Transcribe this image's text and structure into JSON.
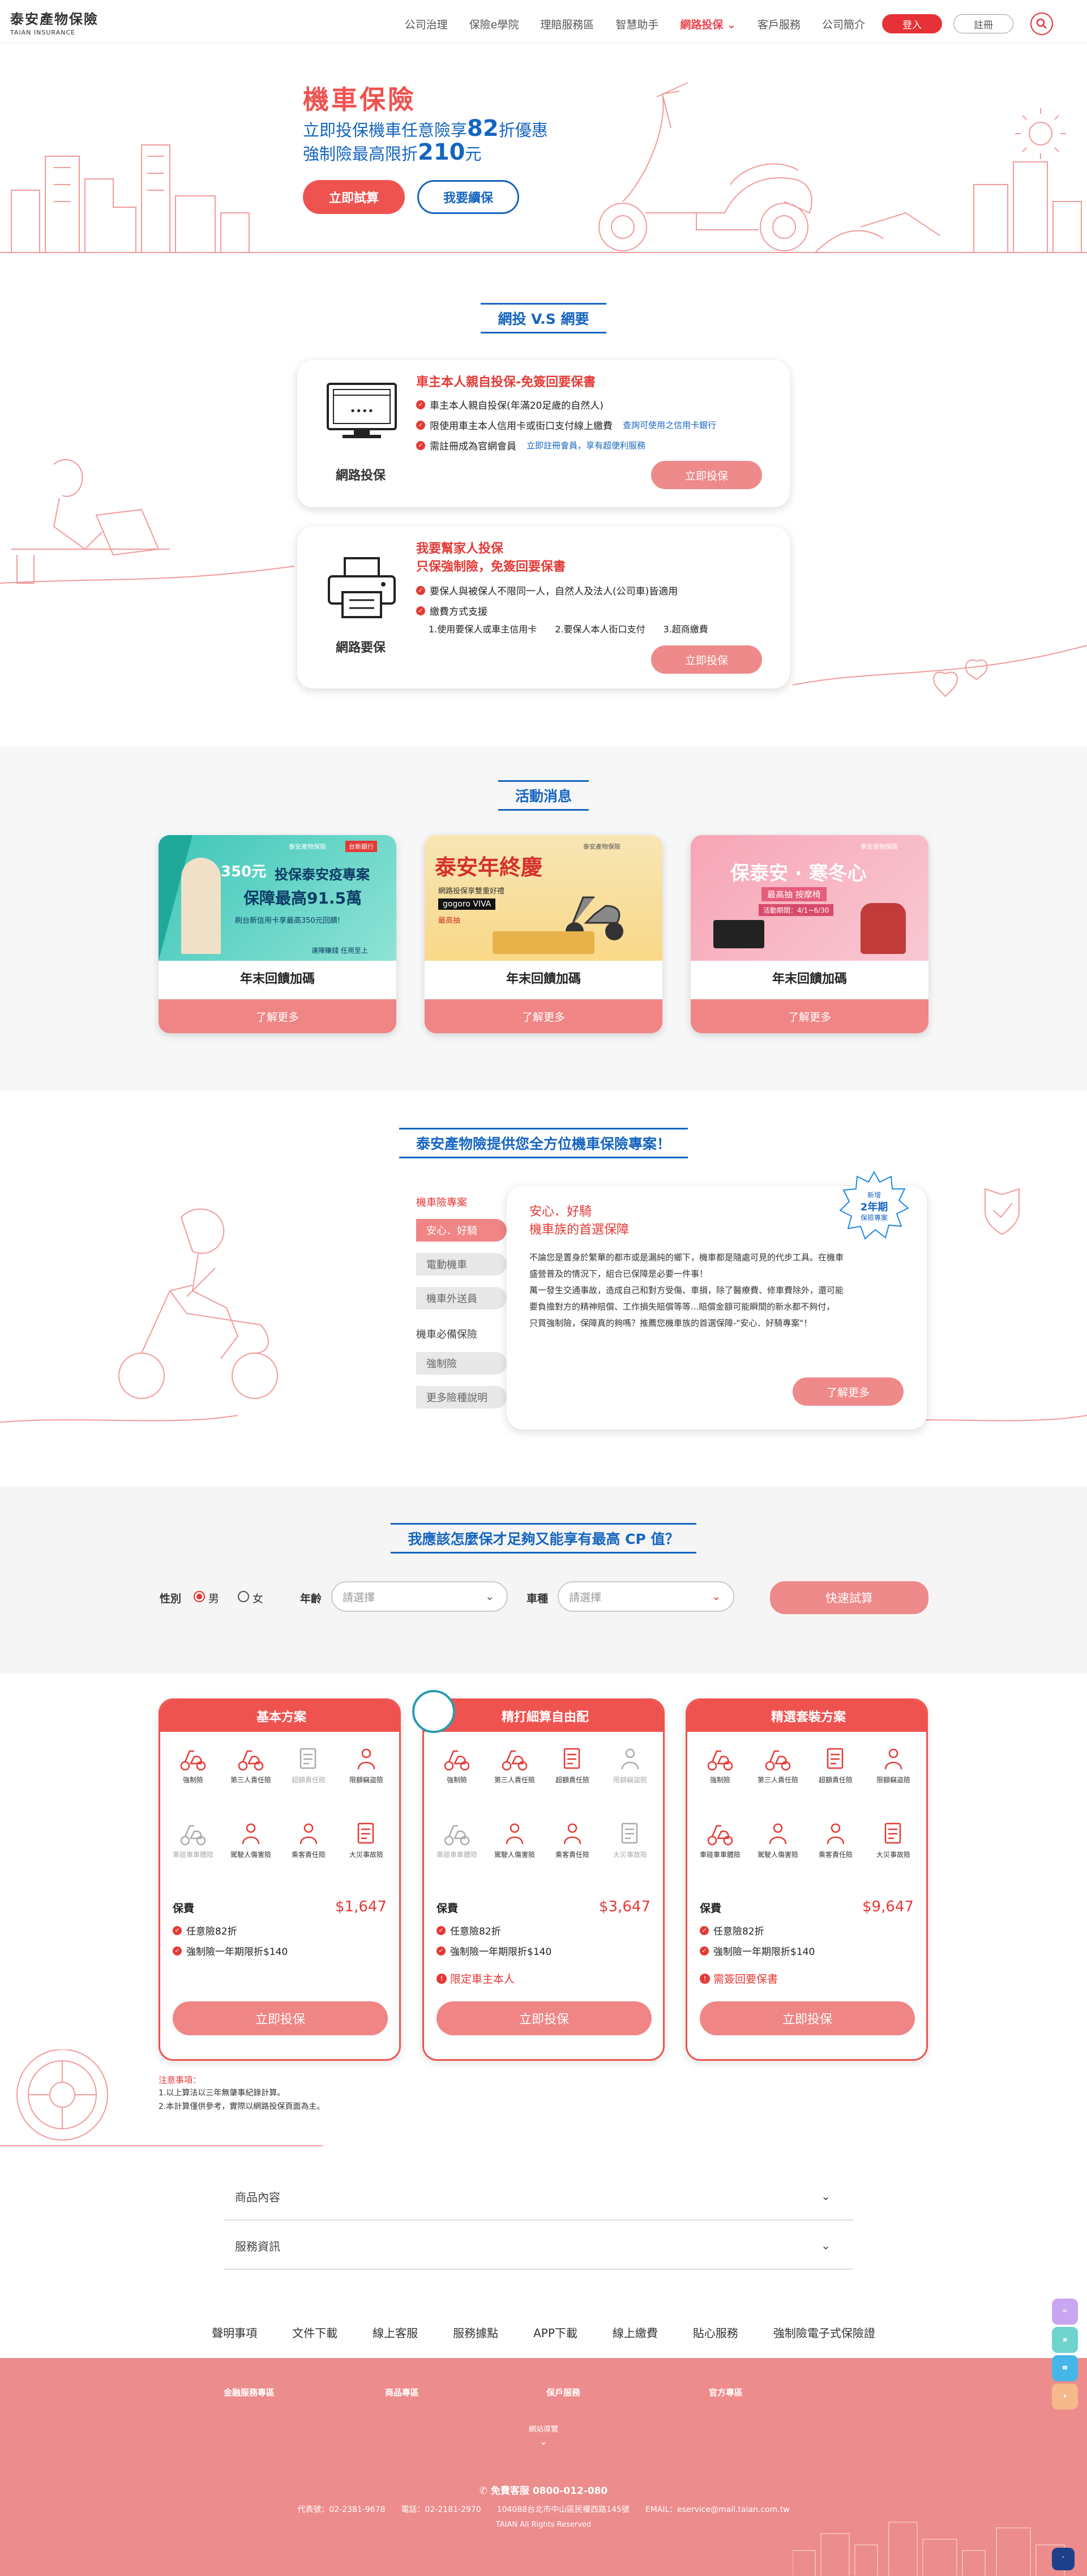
{
  "header": {
    "logo_zh": "泰安產物保險",
    "logo_en": "TAIAN INSURANCE",
    "nav": [
      "公司治理",
      "保險e學院",
      "理賠服務區",
      "智慧助手",
      "網路投保",
      "客戶服務",
      "公司簡介"
    ],
    "active_nav": "網路投保",
    "login": "登入",
    "register": "註冊"
  },
  "hero": {
    "title": "機車保險",
    "line1_pre": "立即投保機車任意險享",
    "line1_num": "82",
    "line1_post": "折優惠",
    "line2_pre": "強制險最高限折",
    "line2_num": "210",
    "line2_post": "元",
    "btn_try": "立即試算",
    "btn_renew": "我要續保"
  },
  "compare": {
    "title": "網投 V.S 網要",
    "online": {
      "label": "網路投保",
      "heading": "車主本人親自投保-免簽回要保書",
      "bullets": [
        "車主本人親自投保(年滿20足歲的自然人)",
        "限使用車主本人信用卡或街口支付線上繳費",
        "需註冊成為官網會員"
      ],
      "link1": "查詢可使用之信用卡銀行",
      "link2": "立即註冊會員，享有超便利服務",
      "button": "立即投保"
    },
    "request": {
      "label": "網路要保",
      "heading1": "我要幫家人投保",
      "heading2": "只保強制險，免簽回要保書",
      "bullets": [
        "要保人與被保人不限同一人，自然人及法人(公司車)皆適用",
        "繳費方式支援"
      ],
      "methods": "1.使用要保人或車主信用卡　　2.要保人本人街口支付　　3.超商繳費",
      "button": "立即投保"
    }
  },
  "promos": {
    "title": "活動消息",
    "items": [
      {
        "title": "年末回饋加碼",
        "button": "了解更多",
        "img_lines": [
          "350元",
          "投保泰安疫專案",
          "保障最高91.5萬",
          "刷台新信用卡享最高350元回饋!",
          "達陣賺錢 任用至上"
        ],
        "brand": "泰安產物保險",
        "bank": "台新銀行"
      },
      {
        "title": "年末回饋加碼",
        "button": "了解更多",
        "img_lines": [
          "泰安年終慶",
          "網路投保享雙重好禮",
          "gogoro VIVA",
          "最高抽"
        ],
        "brand": "泰安產物保險"
      },
      {
        "title": "年末回饋加碼",
        "button": "了解更多",
        "img_lines": [
          "保泰安 · 寒冬心",
          "最高抽 按摩椅",
          "活動期間：4/1~6/30"
        ],
        "brand": "泰安產物保險"
      }
    ]
  },
  "features": {
    "title": "泰安產物險提供您全方位機車保險專案！",
    "category1": "機車險專案",
    "menu1": [
      "安心．好騎",
      "電動機車",
      "機車外送員"
    ],
    "category2": "機車必備保險",
    "menu2": [
      "強制險",
      "更多險種說明"
    ],
    "card_title1": "安心．好騎",
    "card_title2": "機車族的首選保障",
    "badge": [
      "新增",
      "2年期",
      "保險專案"
    ],
    "body": [
      "不論您是置身於繁華的都市或是漏純的鄉下，機車都是隨處可見的代步工具。在機車",
      "盛營普及的情況下，組合已保障是必要一件事！",
      "萬一發生交通事故，造成自己和對方受傷、車損，除了醫療費、修車費除外，還可能",
      "要負擔對方的精神賠償、工作損失賠償等等...賠償金額可能瞬間的新水都不夠付，",
      "只買強制險，保障真的夠嗎？推薦您機車族的首選保障-\"安心．好騎專案\"！"
    ],
    "button": "了解更多"
  },
  "calc": {
    "title": "我應該怎麼保才足夠又能享有最高 CP 值？",
    "gender_label": "性別",
    "male": "男",
    "female": "女",
    "age_label": "年齡",
    "age_placeholder": "請選擇",
    "type_label": "車種",
    "type_placeholder": "請選擇",
    "button": "快速試算"
  },
  "plans": [
    {
      "name": "基本方案",
      "coverage": [
        {
          "label": "強制險",
          "on": true
        },
        {
          "label": "第三人責任險",
          "on": true
        },
        {
          "label": "超額責任險",
          "on": false
        },
        {
          "label": "限額竊盜險",
          "on": true
        },
        {
          "label": "車碰車車體險",
          "on": false
        },
        {
          "label": "駕駛人傷害險",
          "on": true
        },
        {
          "label": "乘客責任險",
          "on": true
        },
        {
          "label": "大災事故險",
          "on": true
        }
      ],
      "fee_label": "保費",
      "price": "$1,647",
      "lines": [
        "任意險82折",
        "強制險一年期限折$140"
      ],
      "warn": "",
      "button": "立即投保"
    },
    {
      "name": "精打細算自由配",
      "coverage": [
        {
          "label": "強制險",
          "on": true
        },
        {
          "label": "第三人責任險",
          "on": true
        },
        {
          "label": "超額責任險",
          "on": true
        },
        {
          "label": "限額竊盜險",
          "on": false
        },
        {
          "label": "車碰車車體險",
          "on": false
        },
        {
          "label": "駕駛人傷害險",
          "on": true
        },
        {
          "label": "乘客責任險",
          "on": true
        },
        {
          "label": "大災事故險",
          "on": false
        }
      ],
      "fee_label": "保費",
      "price": "$3,647",
      "lines": [
        "任意險82折",
        "強制險一年期限折$140"
      ],
      "warn": "限定車主本人",
      "button": "立即投保"
    },
    {
      "name": "精選套裝方案",
      "coverage": [
        {
          "label": "強制險",
          "on": true
        },
        {
          "label": "第三人責任險",
          "on": true
        },
        {
          "label": "超額責任險",
          "on": true
        },
        {
          "label": "限額竊盜險",
          "on": true
        },
        {
          "label": "車碰車車體險",
          "on": true
        },
        {
          "label": "駕駛人傷害險",
          "on": true
        },
        {
          "label": "乘客責任險",
          "on": true
        },
        {
          "label": "大災事故險",
          "on": true
        }
      ],
      "fee_label": "保費",
      "price": "$9,647",
      "lines": [
        "任意險82折",
        "強制險一年期限折$140"
      ],
      "warn": "需簽回要保書",
      "button": "立即投保"
    }
  ],
  "notes": {
    "title": "注意事項：",
    "lines": [
      "1.以上算法以三年無肇事紀錄計算。",
      "2.本計算僅供參考，實際以網路投保頁面為主。"
    ]
  },
  "accordion": [
    "商品內容",
    "服務資訊"
  ],
  "footer": {
    "links": [
      "聲明事項",
      "文件下載",
      "線上客服",
      "服務據點",
      "APP下載",
      "線上繳費",
      "貼心服務",
      "強制險電子式保險證"
    ],
    "cols": [
      "金融服務專區",
      "商品專區",
      "保戶服務",
      "官方專區"
    ],
    "site_nav": "網站導覽",
    "hotline": "免費客服 0800-012-080",
    "contact": "代表號：02-2381-9678　　電話：02-2181-2970　　104088台北市中山區民權西路145號　　EMAIL：eservice@mail.taian.com.tw",
    "copyright": "TAIAN All Rights Reserved"
  },
  "colors": {
    "brand_red": "#e53935",
    "pink": "#ef8585",
    "blue": "#1565c0"
  }
}
